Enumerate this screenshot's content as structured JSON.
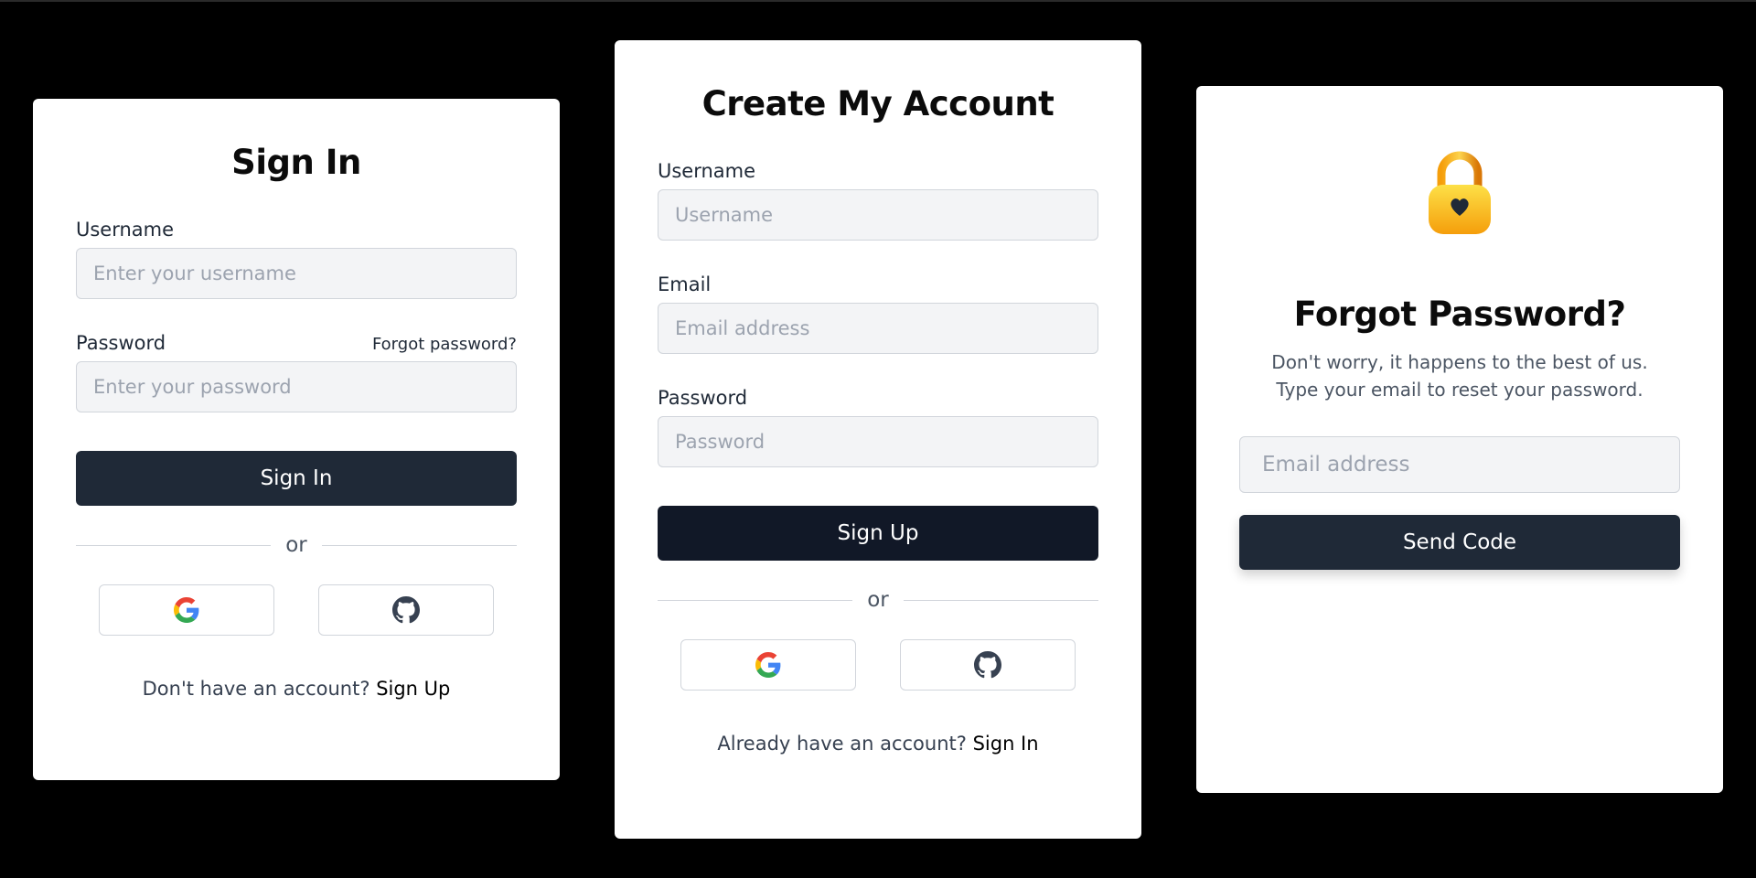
{
  "signin": {
    "title": "Sign In",
    "username_label": "Username",
    "username_placeholder": "Enter your username",
    "password_label": "Password",
    "forgot_link": "Forgot password?",
    "password_placeholder": "Enter your password",
    "submit_label": "Sign In",
    "divider_text": "or",
    "social": [
      "google-icon",
      "github-icon"
    ],
    "footer_text": "Don't have an account?",
    "footer_link": "Sign Up"
  },
  "signup": {
    "title": "Create My Account",
    "username_label": "Username",
    "username_placeholder": "Username",
    "email_label": "Email",
    "email_placeholder": "Email address",
    "password_label": "Password",
    "password_placeholder": "Password",
    "submit_label": "Sign Up",
    "divider_text": "or",
    "social": [
      "google-icon",
      "github-icon"
    ],
    "footer_text": "Already have an account?",
    "footer_link": "Sign In"
  },
  "forgot": {
    "icon": "lock-heart-icon",
    "title": "Forgot Password?",
    "subtitle_line1": "Don't worry, it happens to the best of us.",
    "subtitle_line2": "Type your email to reset your password.",
    "email_placeholder": "Email address",
    "submit_label": "Send Code"
  },
  "colors": {
    "background": "#000000",
    "card": "#ffffff",
    "primary_button": "#1f2937",
    "input_bg": "#f3f4f6",
    "lock": "#fbbf24"
  }
}
